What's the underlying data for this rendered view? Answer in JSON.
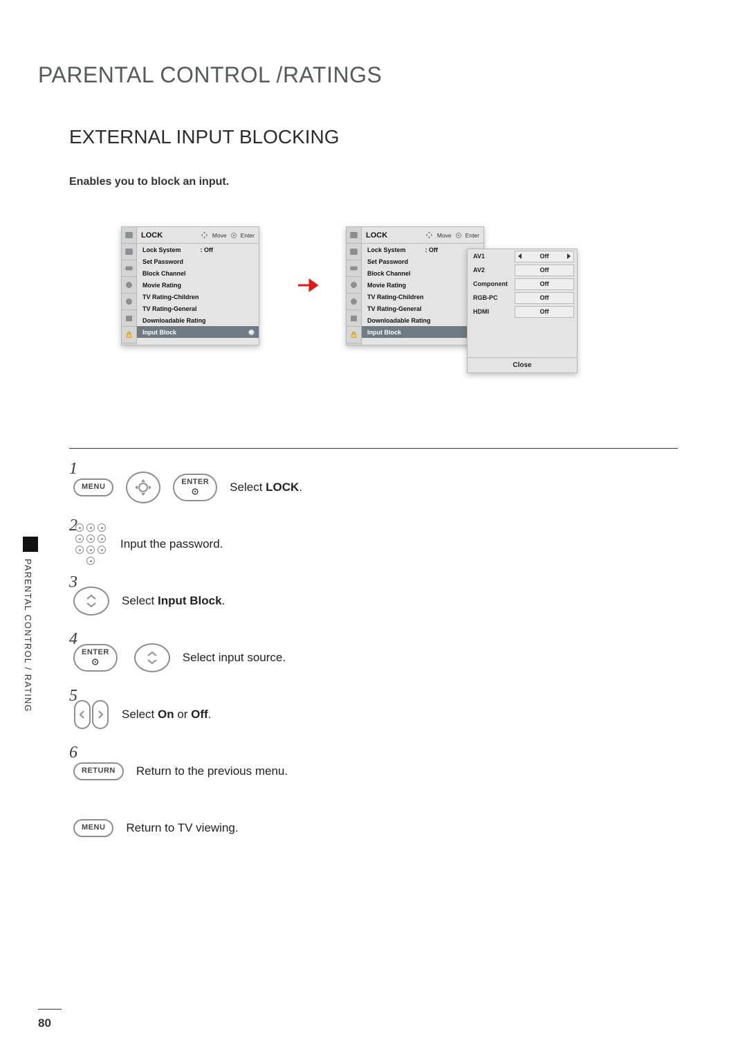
{
  "page_number": "80",
  "side_tab": "PARENTAL CONTROL / RATING",
  "h1": "PARENTAL CONTROL /RATINGS",
  "h2": "EXTERNAL INPUT BLOCKING",
  "desc": "Enables you to block an input.",
  "osd": {
    "title": "LOCK",
    "hint_move": "Move",
    "hint_enter": "Enter",
    "items": [
      {
        "label": "Lock System",
        "value": ": Off"
      },
      {
        "label": "Set Password"
      },
      {
        "label": "Block Channel"
      },
      {
        "label": "Movie Rating"
      },
      {
        "label": "TV Rating-Children"
      },
      {
        "label": "TV Rating-General"
      },
      {
        "label": "Downloadable Rating"
      },
      {
        "label": "Input Block"
      }
    ],
    "right_lock_value": ": Off"
  },
  "popup": {
    "rows": [
      {
        "label": "AV1",
        "value": "Off"
      },
      {
        "label": "AV2",
        "value": "Off"
      },
      {
        "label": "Component",
        "value": "Off"
      },
      {
        "label": "RGB-PC",
        "value": "Off"
      },
      {
        "label": "HDMI",
        "value": "Off"
      }
    ],
    "close": "Close"
  },
  "buttons": {
    "menu": "MENU",
    "enter": "ENTER",
    "return": "RETURN"
  },
  "steps": {
    "s1a": "Select ",
    "s1b": "LOCK",
    "s1c": ".",
    "s2": "Input the password.",
    "s3a": "Select ",
    "s3b": "Input Block",
    "s3c": ".",
    "s4": "Select input source.",
    "s5a": "Select ",
    "s5b": "On",
    "s5c": " or ",
    "s5d": "Off",
    "s5e": ".",
    "s6": "Return to the previous menu.",
    "s7": "Return to TV viewing."
  }
}
